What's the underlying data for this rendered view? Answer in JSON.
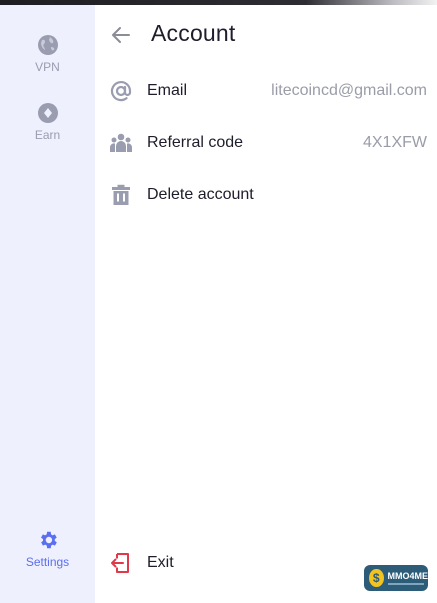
{
  "sidebar": {
    "items": [
      {
        "label": "VPN",
        "icon": "globe-icon"
      },
      {
        "label": "Earn",
        "icon": "coin-icon"
      },
      {
        "label": "Settings",
        "icon": "gear-icon",
        "active": true
      }
    ]
  },
  "header": {
    "title": "Account"
  },
  "rows": [
    {
      "label": "Email",
      "value": "litecoincd@gmail.com",
      "icon": "at-icon"
    },
    {
      "label": "Referral code",
      "value": "4X1XFW",
      "icon": "users-icon"
    },
    {
      "label": "Delete account",
      "icon": "trash-icon"
    }
  ],
  "footer": {
    "exit_label": "Exit",
    "icon": "exit-icon"
  },
  "watermark": {
    "text": "MMO4ME"
  },
  "colors": {
    "accent": "#5b6ef0",
    "danger": "#e03a4a",
    "sidebar_bg": "#eef0fe",
    "muted_icon": "#9a9cb0"
  }
}
